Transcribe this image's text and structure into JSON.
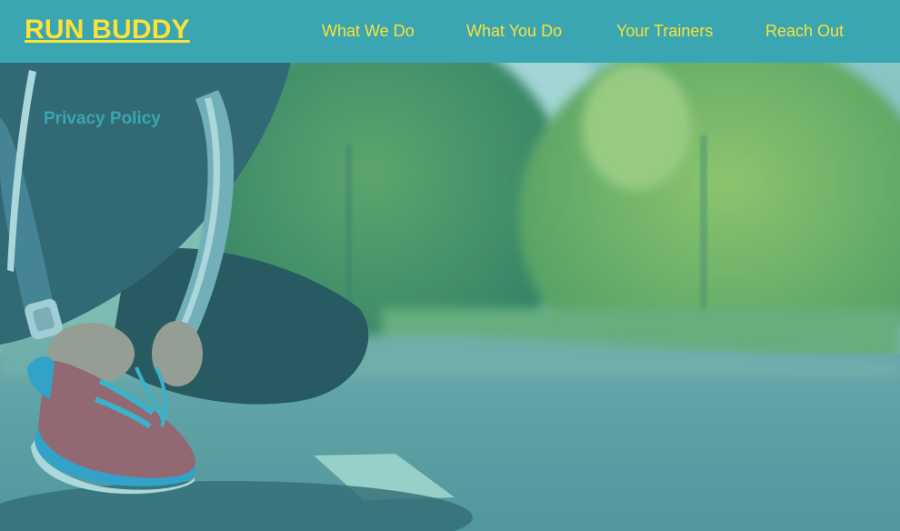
{
  "header": {
    "logo": "RUN BUDDY",
    "nav": [
      {
        "label": "What We Do"
      },
      {
        "label": "What You Do"
      },
      {
        "label": "Your Trainers"
      },
      {
        "label": "Reach Out"
      }
    ]
  },
  "hero": {
    "link": "Privacy Policy",
    "image": "runner-tying-shoe-photo"
  },
  "colors": {
    "primary": "#39a6b2",
    "accent": "#fce138"
  }
}
